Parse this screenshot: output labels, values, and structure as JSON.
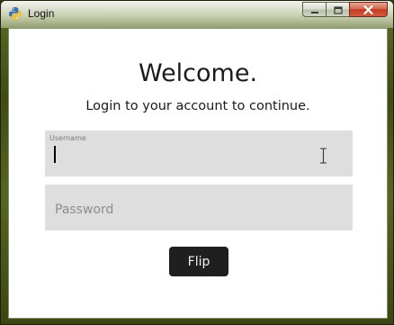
{
  "window": {
    "title": "Login",
    "app_icon": "python-icon",
    "controls": [
      "minimize-icon",
      "maximize-icon",
      "close-icon"
    ]
  },
  "main": {
    "heading": "Welcome.",
    "subheading": "Login to your account to continue.",
    "username": {
      "label": "Username",
      "value": ""
    },
    "password": {
      "placeholder": "Password",
      "value": ""
    },
    "submit_label": "Flip"
  },
  "colors": {
    "field_background": "#dedede",
    "button_background": "#1f1f1f",
    "button_text": "#f2f2f2"
  }
}
